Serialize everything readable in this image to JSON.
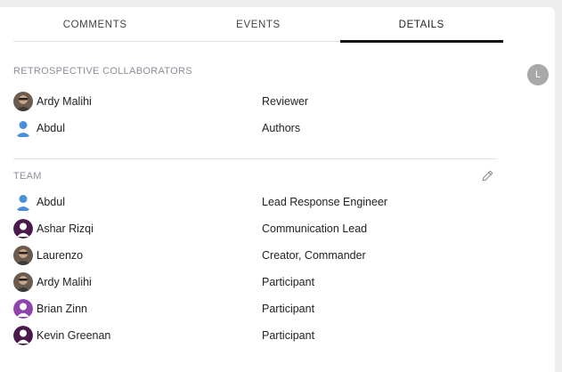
{
  "tabs": [
    {
      "label": "COMMENTS"
    },
    {
      "label": "EVENTS"
    },
    {
      "label": "DETAILS"
    }
  ],
  "collaborators": {
    "title": "RETROSPECTIVE COLLABORATORS",
    "items": [
      {
        "name": "Ardy Malihi",
        "role": "Reviewer",
        "avatar": "photo-avatar"
      },
      {
        "name": "Abdul",
        "role": "Authors",
        "avatar": "default-avatar-blue"
      }
    ]
  },
  "team": {
    "title": "TEAM",
    "edit_icon": "pencil-icon",
    "items": [
      {
        "name": "Abdul",
        "role": "Lead Response Engineer",
        "avatar": "default-avatar-blue"
      },
      {
        "name": "Ashar Rizqi",
        "role": "Communication Lead",
        "avatar": "default-avatar-dark-purple"
      },
      {
        "name": "Laurenzo",
        "role": "Creator, Commander",
        "avatar": "photo-avatar"
      },
      {
        "name": "Ardy Malihi",
        "role": "Participant",
        "avatar": "photo-avatar"
      },
      {
        "name": "Brian Zinn",
        "role": "Participant",
        "avatar": "default-avatar-purple"
      },
      {
        "name": "Kevin Greenan",
        "role": "Participant",
        "avatar": "default-avatar-dark-purple"
      }
    ]
  },
  "side_avatar": {
    "initial": "L"
  },
  "colors": {
    "accent": "#111111",
    "label": "#8a8f98",
    "avatar_blue": "#4a90d9",
    "avatar_purple": "#8e44ad",
    "avatar_dark_purple": "#4a1a4f"
  }
}
